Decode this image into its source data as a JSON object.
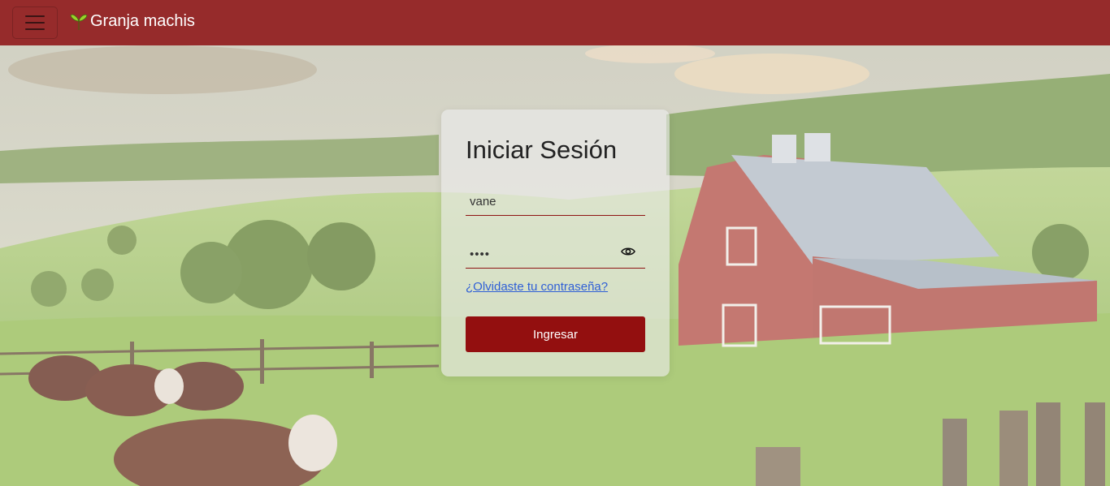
{
  "navbar": {
    "brand": "Granja machis",
    "menu_icon": "hamburger-menu-icon",
    "brand_icon": "sprout-icon",
    "background_color": "#962b2b"
  },
  "login": {
    "title": "Iniciar Sesión",
    "username_value": "vane",
    "password_value": "••••",
    "forgot_link": "¿Olvidaste tu contraseña?",
    "submit_label": "Ingresar",
    "password_toggle_icon": "eye-icon",
    "accent_color": "#930f0f"
  },
  "background": {
    "description_icon": "farm-scene-image"
  }
}
